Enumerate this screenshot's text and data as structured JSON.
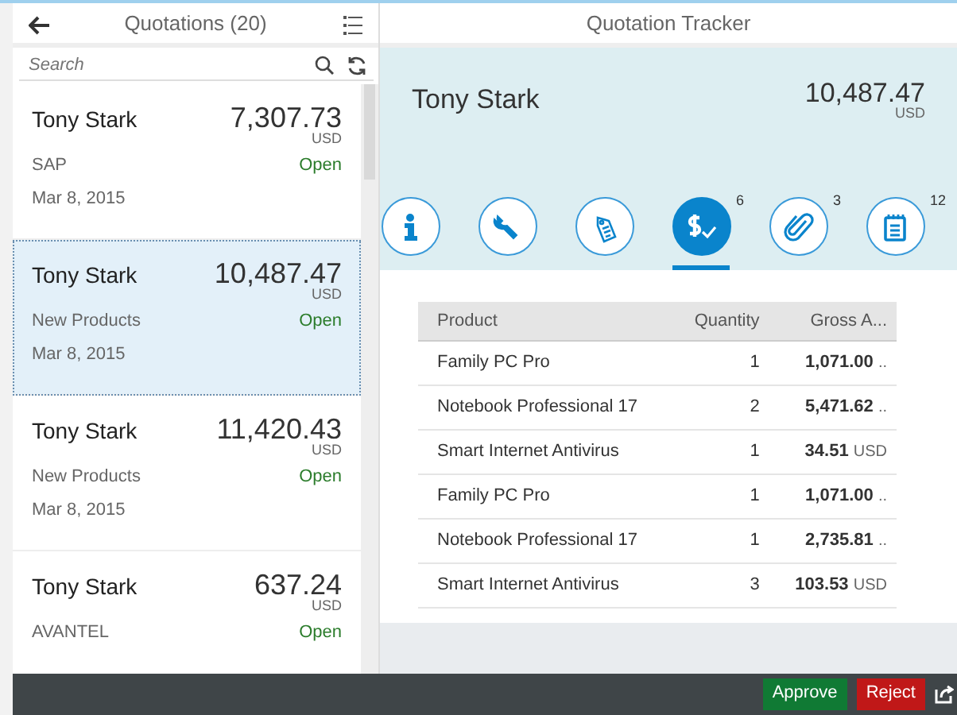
{
  "master": {
    "title": "Quotations (20)",
    "search": {
      "placeholder": "Search"
    },
    "items": [
      {
        "name": "Tony Stark",
        "amount": "7,307.73",
        "currency": "USD",
        "category": "SAP",
        "status": "Open",
        "date": "Mar 8, 2015",
        "selected": false
      },
      {
        "name": "Tony Stark",
        "amount": "10,487.47",
        "currency": "USD",
        "category": "New Products",
        "status": "Open",
        "date": "Mar 8, 2015",
        "selected": true
      },
      {
        "name": "Tony Stark",
        "amount": "11,420.43",
        "currency": "USD",
        "category": "New Products",
        "status": "Open",
        "date": "Mar 8, 2015",
        "selected": false
      },
      {
        "name": "Tony Stark",
        "amount": "637.24",
        "currency": "USD",
        "category": "AVANTEL",
        "status": "Open",
        "selected": false
      }
    ]
  },
  "detail": {
    "title": "Quotation Tracker",
    "header": {
      "name": "Tony Stark",
      "amount": "10,487.47",
      "currency": "USD"
    },
    "tabs": [
      {
        "kind": "info",
        "selected": false
      },
      {
        "kind": "wrench",
        "selected": false
      },
      {
        "kind": "tag",
        "selected": false
      },
      {
        "kind": "pricing",
        "count": "6",
        "selected": true
      },
      {
        "kind": "attachment",
        "count": "3",
        "selected": false
      },
      {
        "kind": "notes",
        "count": "12",
        "selected": false
      }
    ],
    "table": {
      "columns": [
        "Product",
        "Quantity",
        "Gross A..."
      ],
      "rows": [
        {
          "product": "Family PC Pro",
          "quantity": "1",
          "amount": "1,071.00",
          "unit": ".."
        },
        {
          "product": "Notebook Professional 17",
          "quantity": "2",
          "amount": "5,471.62",
          "unit": ".."
        },
        {
          "product": "Smart Internet Antivirus",
          "quantity": "1",
          "amount": "34.51",
          "unit": "USD"
        },
        {
          "product": "Family PC Pro",
          "quantity": "1",
          "amount": "1,071.00",
          "unit": ".."
        },
        {
          "product": "Notebook Professional 17",
          "quantity": "1",
          "amount": "2,735.81",
          "unit": ".."
        },
        {
          "product": "Smart Internet Antivirus",
          "quantity": "3",
          "amount": "103.53",
          "unit": "USD"
        }
      ]
    }
  },
  "footer": {
    "buttons": [
      {
        "label": "Approve",
        "kind": "accept"
      },
      {
        "label": "Reject",
        "kind": "reject"
      }
    ]
  }
}
